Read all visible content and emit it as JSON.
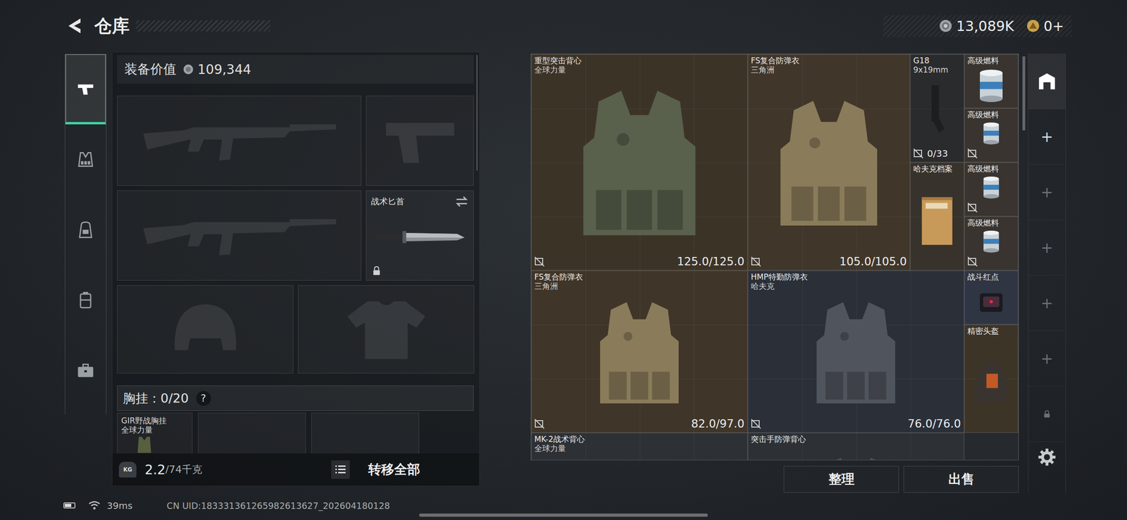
{
  "topbar": {
    "title": "仓库",
    "currencies": [
      {
        "kind": "silver",
        "amount": "13,089K"
      },
      {
        "kind": "gold",
        "amount": "0+"
      }
    ]
  },
  "left_tabs": [
    {
      "kind": "weapon",
      "selected": true
    },
    {
      "kind": "rig",
      "selected": false
    },
    {
      "kind": "backpack",
      "selected": false
    },
    {
      "kind": "container",
      "selected": false
    },
    {
      "kind": "case",
      "selected": false
    }
  ],
  "loadout": {
    "value_label": "装备价值",
    "value": "109,344",
    "slots": [
      {
        "kind": "rifle",
        "filled": false
      },
      {
        "kind": "pistol",
        "filled": false
      },
      {
        "kind": "rifle",
        "filled": false
      },
      {
        "kind": "knife",
        "filled": true,
        "name": "战术匕首",
        "locked": true
      },
      {
        "kind": "helmet",
        "filled": false
      },
      {
        "kind": "armor",
        "filled": false
      }
    ],
    "rig": {
      "label": "胸挂：",
      "count": "0/20",
      "help": "?",
      "slots": [
        {
          "filled": true,
          "name": "GIR野战胸挂",
          "sub": "全球力量"
        },
        {
          "filled": false
        },
        {
          "filled": false
        }
      ]
    },
    "weight": {
      "icon_label": "KG",
      "current": "2.2",
      "capacity": "/74千克"
    },
    "transfer": "转移全部"
  },
  "stash": {
    "items": [
      {
        "name": "重型突击背心",
        "sub": "全球力量",
        "kind": "vest",
        "reading": "125.0/125.0",
        "marked": true,
        "color": "#3c3327"
      },
      {
        "name": "FS复合防弹衣",
        "sub": "三角洲",
        "kind": "vest",
        "reading": "105.0/105.0",
        "marked": true,
        "color": "#40362a"
      },
      {
        "name": "G18",
        "sub": "9x19mm",
        "kind": "pistol",
        "reading": "0/33",
        "marked": true,
        "color": "#2a2b2d"
      },
      {
        "name": "哈夫克档案",
        "kind": "folder",
        "marked": false,
        "color": "#37322c"
      },
      {
        "name": "高级燃料",
        "kind": "fuel",
        "marked": false,
        "color": "#39342f"
      },
      {
        "name": "高级燃料",
        "kind": "fuel",
        "marked": true,
        "color": "#39342f"
      },
      {
        "name": "高级燃料",
        "kind": "fuel",
        "marked": true,
        "color": "#39342f"
      },
      {
        "name": "高级燃料",
        "kind": "fuel",
        "marked": true,
        "color": "#39342f"
      },
      {
        "name": "FS复合防弹衣",
        "sub": "三角洲",
        "kind": "vest",
        "reading": "82.0/97.0",
        "marked": true,
        "color": "#3f3528"
      },
      {
        "name": "HMP特勤防弹衣",
        "sub": "哈夫克",
        "kind": "vest",
        "reading": "76.0/76.0",
        "marked": true,
        "color": "#2b2f38"
      },
      {
        "name": "战斗红点",
        "kind": "sight",
        "marked": false,
        "color": "#2f3542"
      },
      {
        "name": "精密头盔",
        "kind": "helmet",
        "marked": false,
        "color": "#3d3428"
      },
      {
        "name": "MK-2战术背心",
        "sub": "全球力量",
        "kind": "vest",
        "marked": false,
        "color": "#2d3034"
      },
      {
        "name": "突击手防弹背心",
        "kind": "vest",
        "marked": false,
        "color": "#2d3034"
      }
    ],
    "buttons": [
      "整理",
      "出售"
    ]
  },
  "storage_tabs": [
    {
      "kind": "home",
      "selected": true,
      "disabled": false
    },
    {
      "kind": "add",
      "label": "+",
      "selected": false,
      "disabled": false
    },
    {
      "kind": "add",
      "label": "+",
      "selected": false,
      "disabled": true
    },
    {
      "kind": "add",
      "label": "+",
      "selected": false,
      "disabled": true
    },
    {
      "kind": "add",
      "label": "+",
      "selected": false,
      "disabled": true
    },
    {
      "kind": "add",
      "label": "+",
      "selected": false,
      "disabled": true
    },
    {
      "kind": "locked",
      "selected": false,
      "disabled": true
    }
  ],
  "status_bar": {
    "battery": {
      "level": 0.7
    },
    "ping": "39ms",
    "uid": "CN UID:183331361265982613627_202604180128"
  }
}
